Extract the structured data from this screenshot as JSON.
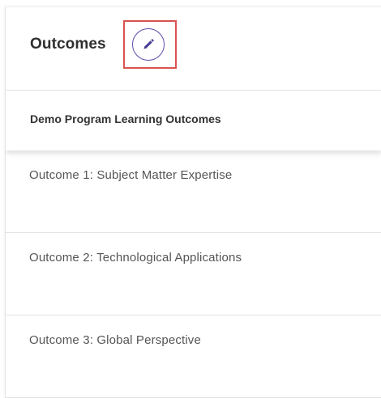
{
  "header": {
    "title": "Outcomes",
    "edit_icon": "pencil-icon"
  },
  "program": {
    "title": "Demo Program Learning Outcomes"
  },
  "outcomes": [
    {
      "label": "Outcome 1: Subject Matter Expertise"
    },
    {
      "label": "Outcome 2: Technological Applications"
    },
    {
      "label": "Outcome 3: Global Perspective"
    }
  ],
  "colors": {
    "accent": "#5a4ea8",
    "highlight": "#d9534f"
  }
}
